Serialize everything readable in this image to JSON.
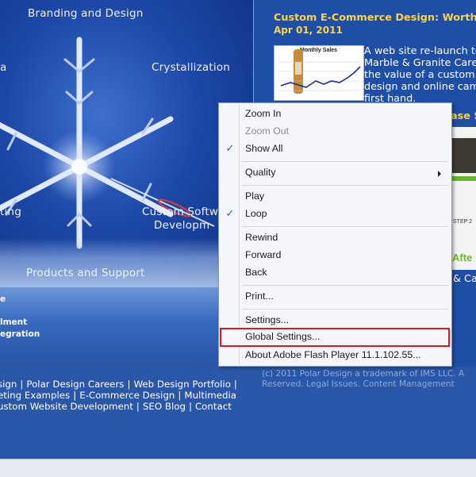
{
  "flash_nav": {
    "branding": "Branding and Design",
    "crystallization": "Crystallization",
    "left_partial_a": "a",
    "left_partial_ting": "ting",
    "custom_software_line1": "Custom Softwa",
    "custom_software_line2": "Developm",
    "products_support": "Products and Support"
  },
  "strip": {
    "item1": "e",
    "item2": "lment",
    "item3": "egration"
  },
  "footer_links": {
    "line1": [
      "sign",
      "Polar Design Careers",
      "Web Design Portfolio",
      ""
    ],
    "line2": [
      "eting Examples",
      "E-Commerce Design",
      "Multimedia"
    ],
    "line3": [
      "ustom Website Development",
      "SEO Blog",
      "Contact"
    ]
  },
  "post": {
    "title": "Custom E-Commerce Design: Worth the",
    "date": "Apr 01, 2011",
    "thumb_caption": "Monthly Sales",
    "text_lines": [
      "A web site re-launch to",
      "Marble & Granite Care",
      "the value of a custom",
      "design and online cam",
      "first hand."
    ]
  },
  "case_study": {
    "title_partial": "ase S",
    "thumb_step": "STEP 2",
    "thumb_after": "Afte",
    "text_partial": "& Ca"
  },
  "copyright": {
    "line1": "(c) 2011 Polar Design a trademark of IMS LLC. A",
    "line2": "Reserved. Legal Issues. Content Management"
  },
  "context_menu": {
    "zoom_in": "Zoom In",
    "zoom_out": "Zoom Out",
    "show_all": "Show All",
    "quality": "Quality",
    "play": "Play",
    "loop": "Loop",
    "rewind": "Rewind",
    "forward": "Forward",
    "back": "Back",
    "print": "Print...",
    "settings": "Settings...",
    "global_settings": "Global Settings...",
    "about": "About Adobe Flash Player 11.1.102.55...",
    "check_glyph": "✓"
  },
  "colors": {
    "accent_yellow": "#ffd33a",
    "highlight_red": "#e01826",
    "check_blue": "#1d5bd8",
    "page_blue": "#2a57a8"
  }
}
